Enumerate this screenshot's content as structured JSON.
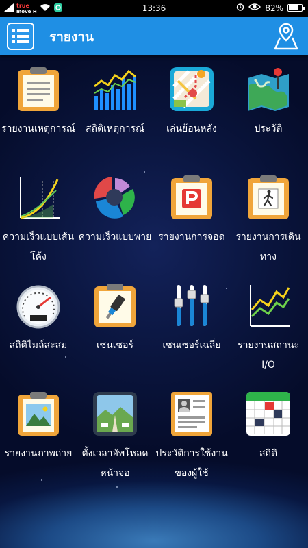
{
  "status_bar": {
    "carrier_top": "true",
    "carrier_bottom": "move H",
    "time": "13:36",
    "battery_percent": "82%",
    "battery_level": 0.82
  },
  "app_bar": {
    "title": "รายงาน",
    "color": "#1f8fe4"
  },
  "menu": {
    "items": [
      {
        "label": "รายงานเหตุการณ์",
        "icon": "clipboard-report-icon"
      },
      {
        "label": "สถิติเหตุการณ์",
        "icon": "bar-line-chart-icon"
      },
      {
        "label": "เล่นย้อนหลัง",
        "icon": "route-map-icon"
      },
      {
        "label": "ประวัติ",
        "icon": "map-pin-icon"
      },
      {
        "label": "ความเร็วแบบเส้นโค้ง",
        "icon": "speed-curve-icon"
      },
      {
        "label": "ความเร็วแบบพาย",
        "icon": "pie-chart-icon"
      },
      {
        "label": "รายงานการจอด",
        "icon": "parking-report-icon"
      },
      {
        "label": "รายงานการเดินทาง",
        "icon": "walking-report-icon"
      },
      {
        "label": "สถิติไมล์สะสม",
        "icon": "speedometer-icon"
      },
      {
        "label": "เซนเซอร์",
        "icon": "sensor-report-icon"
      },
      {
        "label": "เซนเซอร์เฉลี่ย",
        "icon": "sliders-icon"
      },
      {
        "label": "รายงานสถานะ I/O",
        "icon": "io-chart-icon"
      },
      {
        "label": "รายงานภาพถ่าย",
        "icon": "photo-report-icon"
      },
      {
        "label": "ตั้งเวลาอัพโหลดหน้าจอ",
        "icon": "screen-upload-icon"
      },
      {
        "label": "ประวัติการใช้งานของผู้ใช้",
        "icon": "user-profile-icon"
      },
      {
        "label": "สถิติ",
        "icon": "calendar-grid-icon"
      }
    ]
  }
}
